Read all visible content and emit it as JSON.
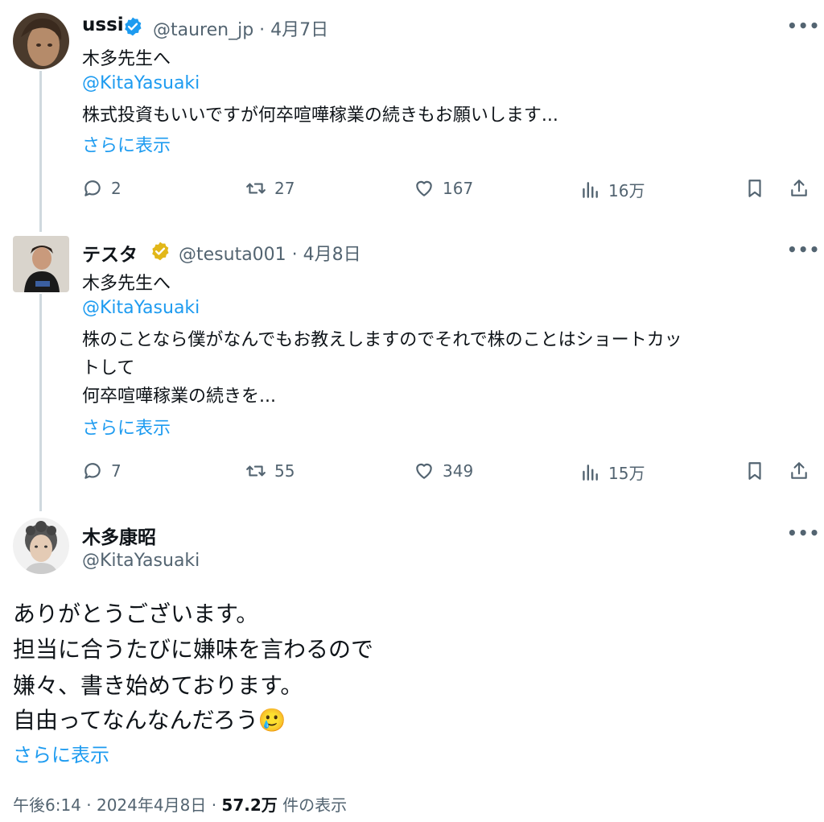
{
  "tweets": [
    {
      "name": "ussi",
      "handle_date": "@tauren_jp · 4月7日",
      "verified_color": "#1d9bf0",
      "line1": "木多先生へ",
      "mention": "@KitaYasuaki",
      "line2": "株式投資もいいですが何卒喧嘩稼業の続きもお願いします...",
      "more": "さらに表示",
      "replies": "2",
      "retweets": "27",
      "likes": "167",
      "views": "16万"
    },
    {
      "name": "テスタ",
      "handle_date": "@tesuta001 · 4月8日",
      "verified_color": "#e2b719",
      "line1": "木多先生へ",
      "mention": "@KitaYasuaki",
      "line2": "株のことなら僕がなんでもお教えしますのでそれで株のことはショートカッ",
      "line3": "トして",
      "line4": "何卒喧嘩稼業の続きを...",
      "more": "さらに表示",
      "replies": "7",
      "retweets": "55",
      "likes": "349",
      "views": "15万"
    }
  ],
  "main": {
    "name": "木多康昭",
    "handle": "@KitaYasuaki",
    "lines": [
      "ありがとうございます。",
      "担当に合うたびに嫌味を言わるので",
      "嫌々、書き始めております。",
      "自由ってなんなんだろう"
    ],
    "emoji": "🥲",
    "more": "さらに表示",
    "time_date": "午後6:14 · 2024年4月8日 · ",
    "views_count": "57.2万",
    "views_label": " 件の表示"
  },
  "icons": [
    "reply-icon",
    "retweet-icon",
    "like-icon",
    "views-icon",
    "bookmark-icon",
    "share-icon",
    "more-icon",
    "verified-badge-icon"
  ],
  "colors": {
    "link": "#1d9bf0",
    "muted": "#536471",
    "text": "#0f1419"
  }
}
